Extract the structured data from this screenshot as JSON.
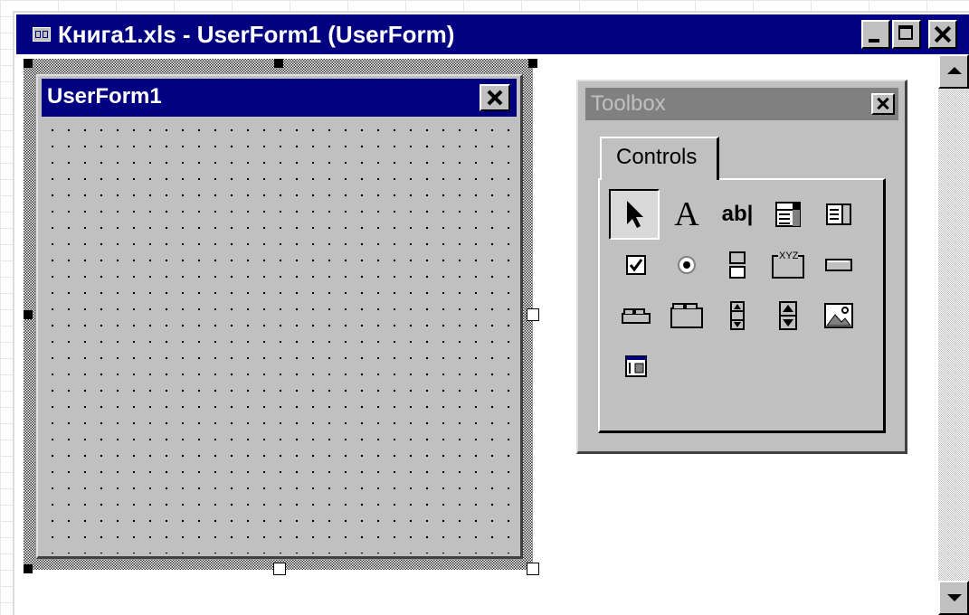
{
  "window": {
    "title": "Книга1.xls - UserForm1 (UserForm)"
  },
  "userform": {
    "title": "UserForm1"
  },
  "toolbox": {
    "title": "Toolbox",
    "tab_label": "Controls",
    "tools": [
      {
        "name": "select-objects-tool",
        "glyph": ""
      },
      {
        "name": "label-tool",
        "glyph": "A"
      },
      {
        "name": "textbox-tool",
        "glyph": "ab|"
      },
      {
        "name": "combobox-tool",
        "glyph": ""
      },
      {
        "name": "listbox-tool",
        "glyph": ""
      },
      {
        "name": "checkbox-tool",
        "glyph": ""
      },
      {
        "name": "optionbutton-tool",
        "glyph": ""
      },
      {
        "name": "togglebutton-tool",
        "glyph": ""
      },
      {
        "name": "frame-tool",
        "glyph": "XYZ"
      },
      {
        "name": "commandbutton-tool",
        "glyph": ""
      },
      {
        "name": "tabstrip-tool",
        "glyph": ""
      },
      {
        "name": "multipage-tool",
        "glyph": ""
      },
      {
        "name": "scrollbar-tool",
        "glyph": ""
      },
      {
        "name": "spinbutton-tool",
        "glyph": ""
      },
      {
        "name": "image-tool",
        "glyph": ""
      },
      {
        "name": "refedit-tool",
        "glyph": ""
      }
    ]
  }
}
